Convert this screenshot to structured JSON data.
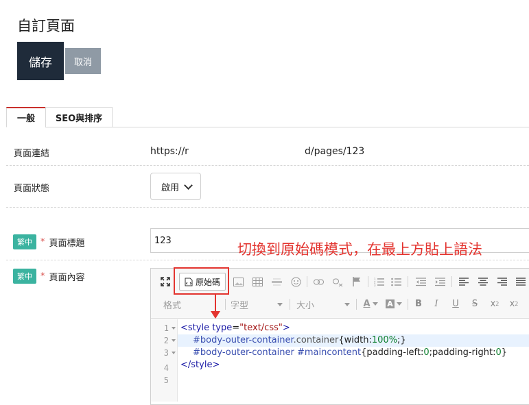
{
  "page": {
    "title": "自訂頁面",
    "save_label": "儲存",
    "cancel_label": "取消"
  },
  "tabs": [
    {
      "label": "一般",
      "active": true
    },
    {
      "label": "SEO與排序",
      "active": false
    }
  ],
  "fields": {
    "link_label": "頁面連結",
    "link_value_left": "https://r",
    "link_value_right": "d/pages/123",
    "status_label": "頁面狀態",
    "status_value": "啟用",
    "lang_badge": "繁中",
    "required_mark": "*",
    "title_label": "頁面標題",
    "title_value": "123",
    "content_label": "頁面內容"
  },
  "annotation": "切換到原始碼模式，在最上方貼上語法",
  "editor": {
    "source_button": "原始碼",
    "format_placeholder": "格式",
    "font_placeholder": "字型",
    "size_placeholder": "大小",
    "line_numbers": [
      "1",
      "2",
      "3",
      "4",
      "5"
    ],
    "code": {
      "l1_open": "<style ",
      "l1_attr": "type",
      "l1_eq": "=",
      "l1_str": "\"text/css\"",
      "l1_close": ">",
      "l2_sel": "#body-outer-container",
      "l2_cls": ".container",
      "l2_prop": "{width:",
      "l2_num": "100%",
      "l2_end": ";}",
      "l3_sel": "#body-outer-container #maincontent",
      "l3_prop1": "{padding-left:",
      "l3_num1": "0",
      "l3_prop2": ";padding-right:",
      "l3_num2": "0",
      "l3_end": "}",
      "l4": "</style>"
    }
  },
  "colors": {
    "save_bg": "#1f2b3a",
    "cancel_bg": "#8f9aa5",
    "badge_bg": "#3bb3a0",
    "annotation_red": "#e3342f"
  }
}
